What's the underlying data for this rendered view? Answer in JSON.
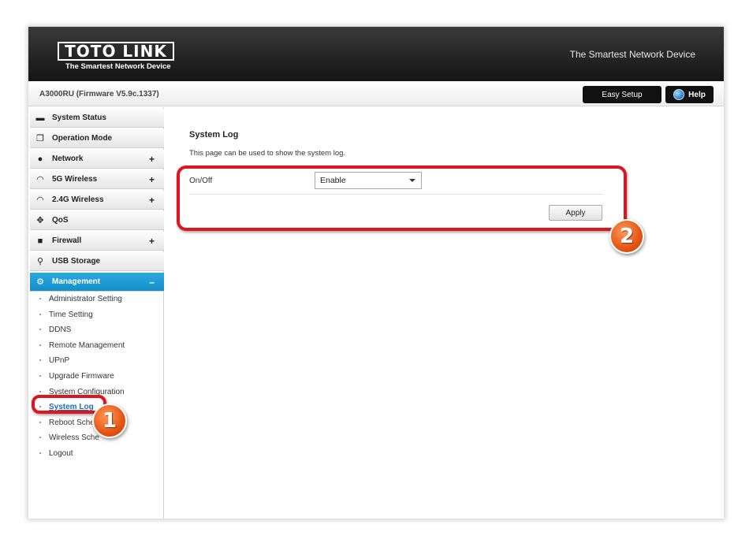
{
  "header": {
    "logo_text": "TOTO LINK",
    "logo_tagline": "The Smartest Network Device",
    "slogan": "The Smartest Network Device"
  },
  "subbar": {
    "firmware": "A3000RU (Firmware V5.9c.1337)",
    "easy_setup_label": "Easy Setup",
    "help_label": "Help"
  },
  "sidebar": {
    "items": [
      {
        "label": "System Status",
        "icon": "chat-bubble-icon",
        "expandable": false
      },
      {
        "label": "Operation Mode",
        "icon": "windows-icon",
        "expandable": false
      },
      {
        "label": "Network",
        "icon": "globe-icon",
        "expandable": true,
        "toggle": "+"
      },
      {
        "label": "5G Wireless",
        "icon": "wifi-icon",
        "expandable": true,
        "toggle": "+"
      },
      {
        "label": "2.4G Wireless",
        "icon": "wifi-icon",
        "expandable": true,
        "toggle": "+"
      },
      {
        "label": "QoS",
        "icon": "qos-icon",
        "expandable": false
      },
      {
        "label": "Firewall",
        "icon": "lock-icon",
        "expandable": true,
        "toggle": "+"
      },
      {
        "label": "USB Storage",
        "icon": "usb-icon",
        "expandable": false
      },
      {
        "label": "Management",
        "icon": "gear-icon",
        "expandable": true,
        "toggle": "–",
        "active": true
      }
    ],
    "sub_items": [
      "Administrator Setting",
      "Time Setting",
      "DDNS",
      "Remote Management",
      "UPnP",
      "Upgrade Firmware",
      "System Configuration",
      "System Log",
      "Reboot Sche",
      "Wireless Sche",
      "Logout"
    ],
    "current_sub_item": "System Log"
  },
  "main": {
    "title": "System Log",
    "description": "This page can be used to show the system log.",
    "onoff_label": "On/Off",
    "onoff_value": "Enable",
    "apply_label": "Apply"
  },
  "annotations": {
    "badge_1": "1",
    "badge_2": "2",
    "highlight_color": "#e0141e",
    "badge_color": "#e55512"
  },
  "colors": {
    "accent": "#1a9fd8",
    "header_bg": "#1e1e1e"
  }
}
